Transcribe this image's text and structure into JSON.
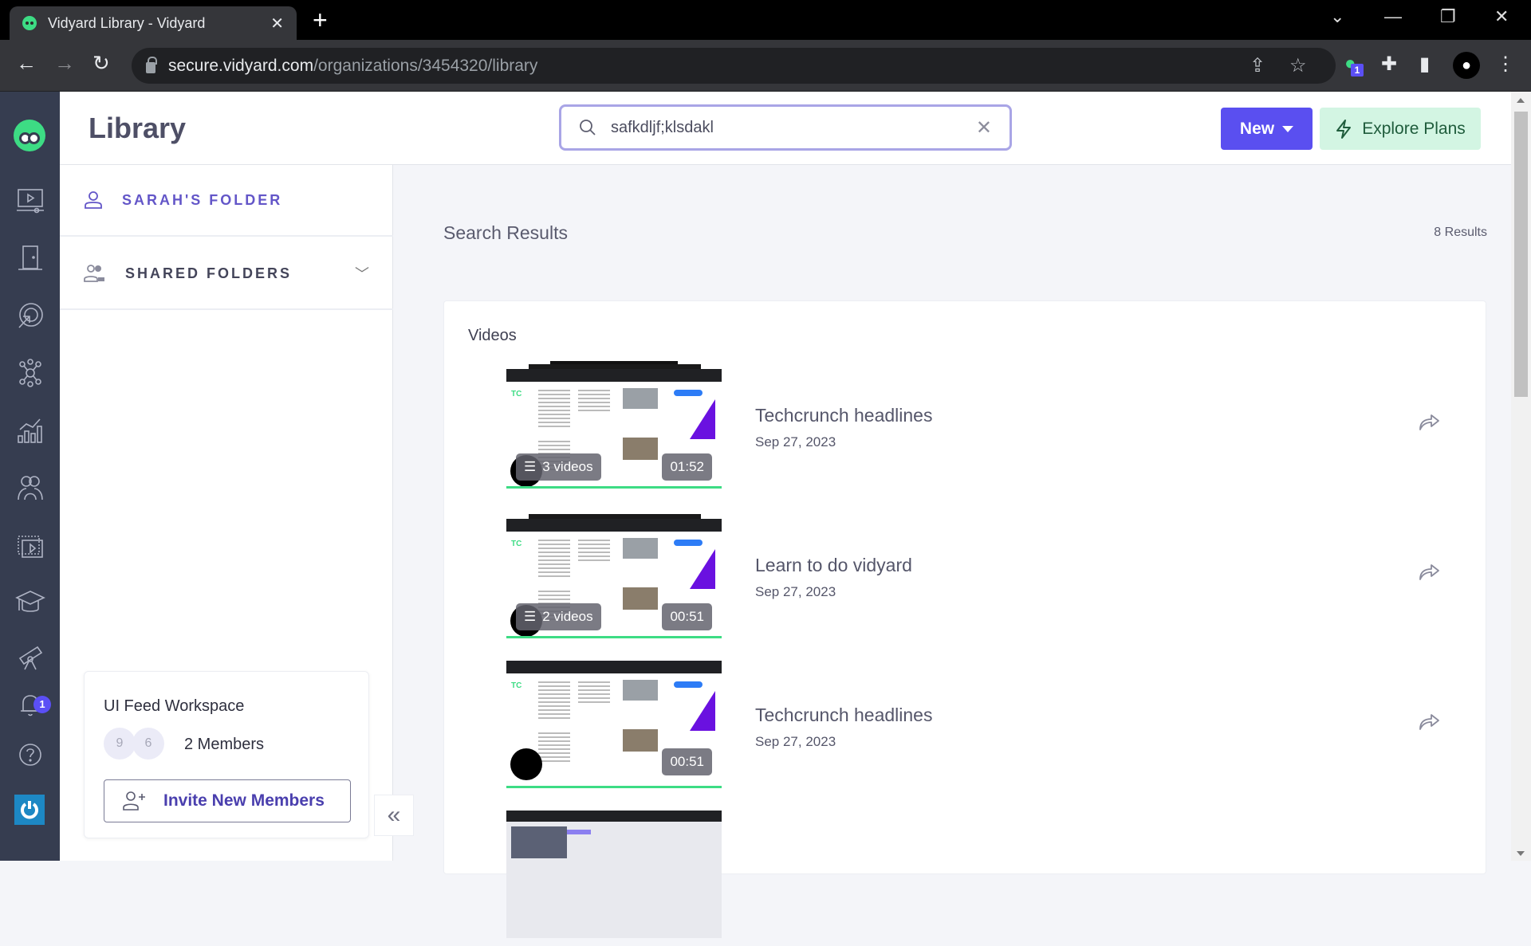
{
  "browser": {
    "tab_title": "Vidyard Library - Vidyard",
    "url_host": "secure.vidyard.com",
    "url_path": "/organizations/3454320/library",
    "extension_badge": "1"
  },
  "app": {
    "brand_color": "#5a4ff0",
    "accent_green": "#3ddc84",
    "sidebar": {
      "items": [
        {
          "icon": "videos-icon"
        },
        {
          "icon": "door-icon"
        },
        {
          "icon": "target-icon"
        },
        {
          "icon": "integrations-icon"
        },
        {
          "icon": "analytics-icon"
        },
        {
          "icon": "team-icon"
        },
        {
          "icon": "playlist-icon"
        },
        {
          "icon": "learning-icon"
        },
        {
          "icon": "telescope-icon"
        },
        {
          "icon": "notifications-icon"
        },
        {
          "icon": "help-icon"
        },
        {
          "icon": "power-icon"
        }
      ],
      "notification_count": "1"
    }
  },
  "header": {
    "title": "Library",
    "search_value": "safkdljf;klsdakl",
    "new_label": "New",
    "explore_label": "Explore Plans"
  },
  "folders": {
    "personal": "SARAH'S FOLDER",
    "shared": "SHARED FOLDERS"
  },
  "workspace": {
    "name": "UI Feed Workspace",
    "avatars": [
      "9",
      "6"
    ],
    "members": "2 Members",
    "invite_label": "Invite New Members"
  },
  "results": {
    "title": "Search Results",
    "count": "8 Results",
    "section": "Videos",
    "videos": [
      {
        "title": "Techcrunch headlines",
        "date": "Sep 27, 2023",
        "playlist": "3 videos",
        "duration": "01:52"
      },
      {
        "title": "Learn to do vidyard",
        "date": "Sep 27, 2023",
        "playlist": "2 videos",
        "duration": "00:51"
      },
      {
        "title": "Techcrunch headlines",
        "date": "Sep 27, 2023",
        "playlist": null,
        "duration": "00:51"
      }
    ]
  }
}
